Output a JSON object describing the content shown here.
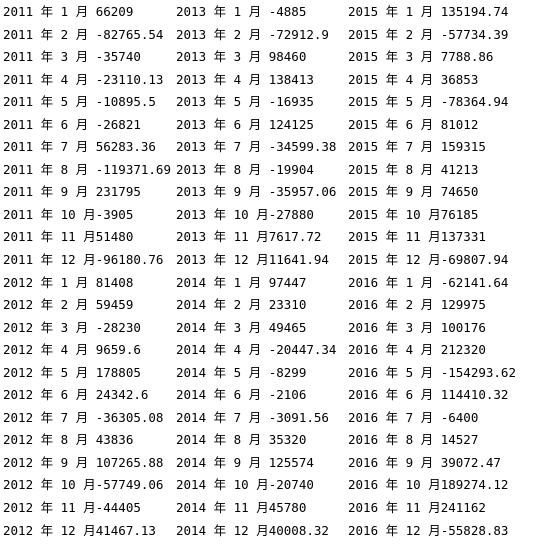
{
  "columns": [
    [
      "2011 年 1 月 66209",
      "2011 年 2 月 -82765.54",
      "2011 年 3 月 -35740",
      "2011 年 4 月 -23110.13",
      "2011 年 5 月 -10895.5",
      "2011 年 6 月 -26821",
      "2011 年 7 月 56283.36",
      "2011 年 8 月 -119371.69",
      "2011 年 9 月 231795",
      "2011 年 10 月-3905",
      "2011 年 11 月51480",
      "2011 年 12 月-96180.76",
      "2012 年 1 月 81408",
      "2012 年 2 月 59459",
      "2012 年 3 月 -28230",
      "2012 年 4 月 9659.6",
      "2012 年 5 月 178805",
      "2012 年 6 月 24342.6",
      "2012 年 7 月 -36305.08",
      "2012 年 8 月 43836",
      "2012 年 9 月 107265.88",
      "2012 年 10 月-57749.06",
      "2012 年 11 月-44405",
      "2012 年 12 月41467.13"
    ],
    [
      "2013 年 1 月 -4885",
      "2013 年 2 月 -72912.9",
      "2013 年 3 月 98460",
      "2013 年 4 月 138413",
      "2013 年 5 月 -16935",
      "2013 年 6 月 124125",
      "2013 年 7 月 -34599.38",
      "2013 年 8 月 -19904",
      "2013 年 9 月 -35957.06",
      "2013 年 10 月-27880",
      "2013 年 11 月7617.72",
      "2013 年 12 月11641.94",
      "2014 年 1 月 97447",
      "2014 年 2 月 23310",
      "2014 年 3 月 49465",
      "2014 年 4 月 -20447.34",
      "2014 年 5 月 -8299",
      "2014 年 6 月 -2106",
      "2014 年 7 月 -3091.56",
      "2014 年 8 月 35320",
      "2014 年 9 月 125574",
      "2014 年 10 月-20740",
      "2014 年 11 月45780",
      "2014 年 12 月40008.32"
    ],
    [
      "2015 年 1 月 135194.74",
      "2015 年 2 月 -57734.39",
      "2015 年 3 月 7788.86",
      "2015 年 4 月 36853",
      "2015 年 5 月 -78364.94",
      "2015 年 6 月 81012",
      "2015 年 7 月 159315",
      "2015 年 8 月 41213",
      "2015 年 9 月 74650",
      "2015 年 10 月76185",
      "2015 年 11 月137331",
      "2015 年 12 月-69807.94",
      "2016 年 1 月 -62141.64",
      "2016 年 2 月 129975",
      "2016 年 3 月 100176",
      "2016 年 4 月 212320",
      "2016 年 5 月 -154293.62",
      "2016 年 6 月 114410.32",
      "2016 年 7 月 -6400",
      "2016 年 8 月 14527",
      "2016 年 9 月 39072.47",
      "2016 年 10 月189274.12",
      "2016 年 11 月241162",
      "2016 年 12 月-55828.83"
    ]
  ]
}
